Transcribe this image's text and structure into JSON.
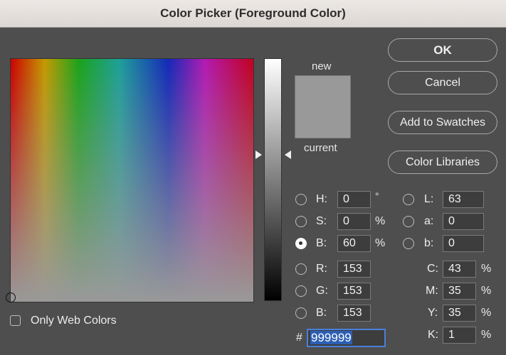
{
  "window": {
    "title": "Color Picker (Foreground Color)"
  },
  "preview": {
    "new_label": "new",
    "current_label": "current",
    "swatch_color": "#999999"
  },
  "buttons": {
    "ok": "OK",
    "cancel": "Cancel",
    "add_to_swatches": "Add to Swatches",
    "color_libraries": "Color Libraries"
  },
  "hsb": {
    "h": {
      "label": "H:",
      "value": "0",
      "unit": "°"
    },
    "s": {
      "label": "S:",
      "value": "0",
      "unit": "%"
    },
    "b": {
      "label": "B:",
      "value": "60",
      "unit": "%",
      "selected": true
    }
  },
  "lab": {
    "l": {
      "label": "L:",
      "value": "63"
    },
    "a": {
      "label": "a:",
      "value": "0"
    },
    "b": {
      "label": "b:",
      "value": "0"
    }
  },
  "rgb": {
    "r": {
      "label": "R:",
      "value": "153"
    },
    "g": {
      "label": "G:",
      "value": "153"
    },
    "b": {
      "label": "B:",
      "value": "153"
    }
  },
  "cmyk": {
    "c": {
      "label": "C:",
      "value": "43",
      "unit": "%"
    },
    "m": {
      "label": "M:",
      "value": "35",
      "unit": "%"
    },
    "y": {
      "label": "Y:",
      "value": "35",
      "unit": "%"
    },
    "k": {
      "label": "K:",
      "value": "1",
      "unit": "%"
    }
  },
  "hex": {
    "label": "#",
    "value": "999999"
  },
  "web_colors": {
    "label": "Only Web Colors",
    "checked": false
  }
}
